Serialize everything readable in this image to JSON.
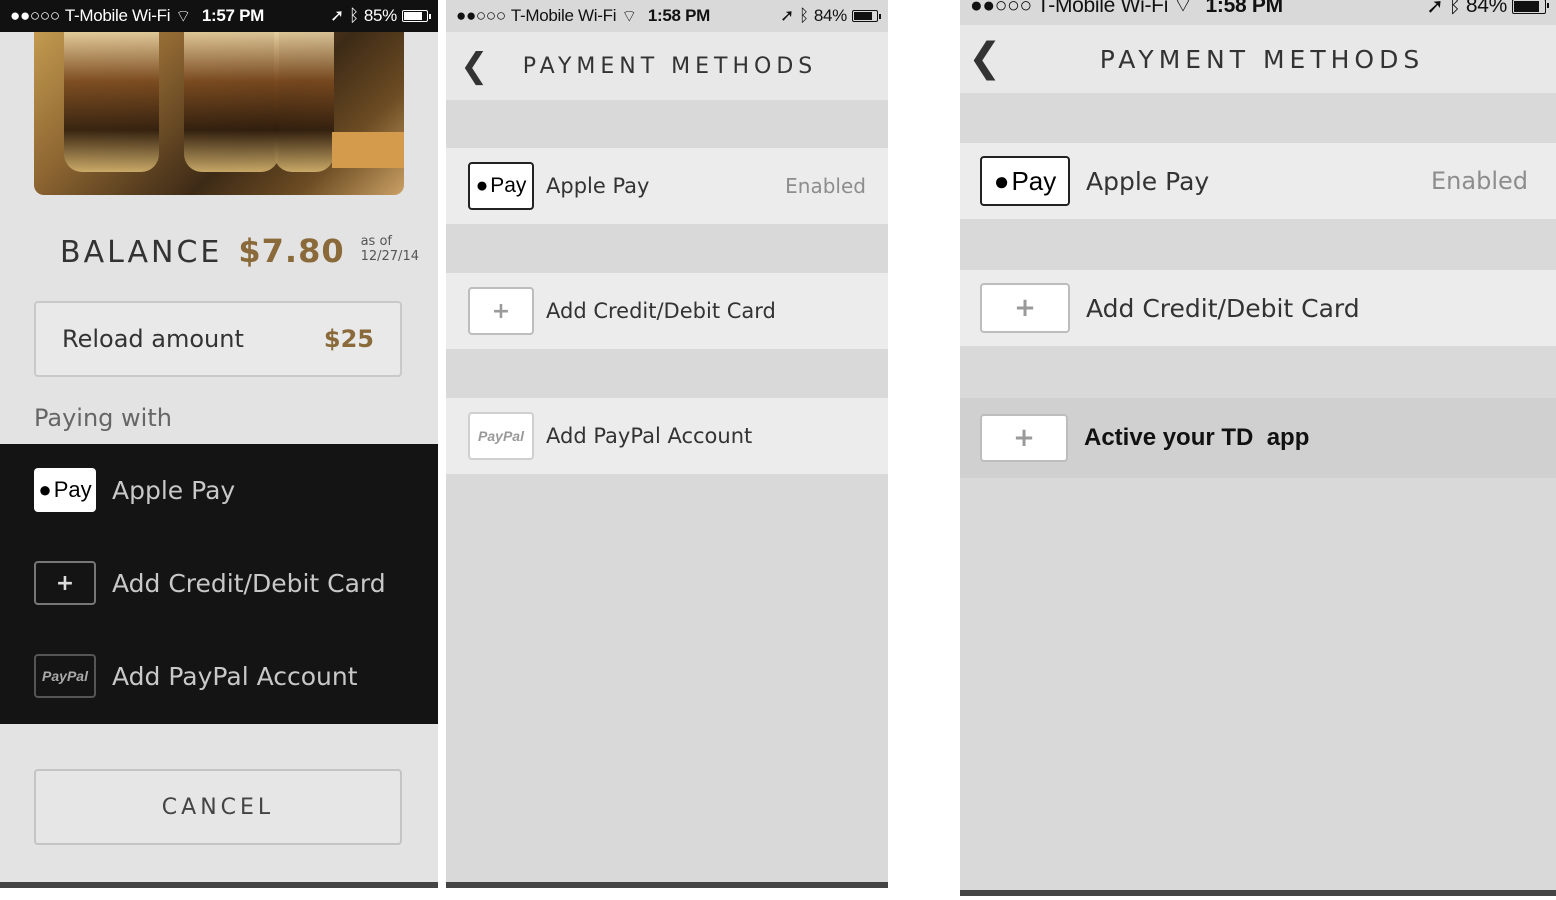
{
  "screens": [
    {
      "status": {
        "carrier": "T-Mobile Wi-Fi",
        "time": "1:57 PM",
        "battery": "85%",
        "battery_fraction": 0.85
      },
      "balance": {
        "label": "BALANCE",
        "amount": "$7.80",
        "as_of_label": "as of",
        "as_of_date": "12/27/14"
      },
      "reload": {
        "label": "Reload amount",
        "amount": "$25"
      },
      "paying_with": "Paying with",
      "options": [
        {
          "badge": "Pay",
          "icon": "apple-pay-icon",
          "label": "Apple Pay"
        },
        {
          "badge": "+",
          "icon": "plus-icon",
          "label": "Add Credit/Debit Card"
        },
        {
          "badge": "PayPal",
          "icon": "paypal-icon",
          "label": "Add PayPal Account"
        }
      ],
      "cancel_label": "CANCEL"
    },
    {
      "status": {
        "carrier": "T-Mobile Wi-Fi",
        "time": "1:58 PM",
        "battery": "84%",
        "battery_fraction": 0.84
      },
      "title": "PAYMENT METHODS",
      "methods": [
        {
          "badge": "Pay",
          "icon": "apple-pay-icon",
          "label": "Apple Pay",
          "status": "Enabled"
        },
        {
          "badge": "+",
          "icon": "plus-icon",
          "label": "Add Credit/Debit Card"
        },
        {
          "badge": "PayPal",
          "icon": "paypal-icon",
          "label": "Add PayPal Account"
        }
      ]
    },
    {
      "status": {
        "carrier": "T-Mobile Wi-Fi",
        "time": "1:58 PM",
        "battery": "84%",
        "battery_fraction": 0.84
      },
      "title": "PAYMENT METHODS",
      "methods": [
        {
          "badge": "Pay",
          "icon": "apple-pay-icon",
          "label": "Apple Pay",
          "status": "Enabled"
        },
        {
          "badge": "+",
          "icon": "plus-icon",
          "label": "Add Credit/Debit Card"
        },
        {
          "badge": "+",
          "icon": "plus-icon",
          "label": "Active your TD  app"
        }
      ]
    }
  ],
  "icons": {
    "back": "chevron-left-icon",
    "signal": "signal-dots-icon",
    "wifi": "wifi-icon",
    "location": "location-arrow-icon",
    "bluetooth": "bluetooth-icon",
    "battery": "battery-icon"
  },
  "colors": {
    "gold": "#8a6a3a",
    "dark_list": "#141414",
    "row_bg": "#ececec",
    "screen_bg": "#d9d9d9",
    "status_gray": "#8d8d8d"
  }
}
